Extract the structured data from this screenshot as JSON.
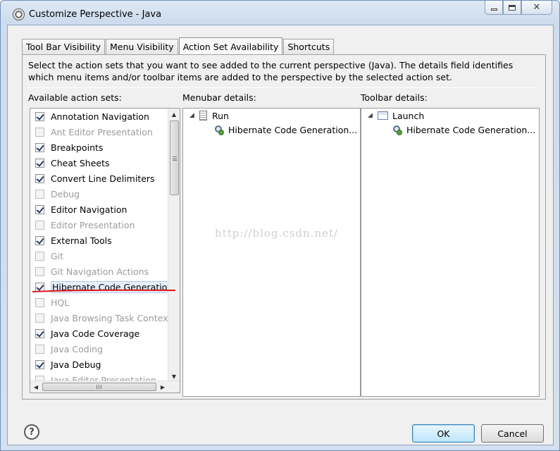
{
  "window": {
    "title": "Customize Perspective - Java"
  },
  "tabs": [
    {
      "label": "Tool Bar Visibility",
      "active": false
    },
    {
      "label": "Menu Visibility",
      "active": false
    },
    {
      "label": "Action Set Availability",
      "active": true
    },
    {
      "label": "Shortcuts",
      "active": false
    }
  ],
  "panel": {
    "description": "Select the action sets that you want to see added to the current perspective (Java).  The details field identifies which menu items and/or toolbar items are added to the perspective by the selected action set.",
    "available_label": "Available action sets:",
    "menubar_label": "Menubar details:",
    "toolbar_label": "Toolbar details:"
  },
  "action_sets": [
    {
      "label": "Annotation Navigation",
      "checked": true,
      "enabled": true
    },
    {
      "label": "Ant Editor Presentation",
      "checked": false,
      "enabled": false
    },
    {
      "label": "Breakpoints",
      "checked": true,
      "enabled": true
    },
    {
      "label": "Cheat Sheets",
      "checked": true,
      "enabled": true
    },
    {
      "label": "Convert Line Delimiters",
      "checked": true,
      "enabled": true
    },
    {
      "label": "Debug",
      "checked": false,
      "enabled": false
    },
    {
      "label": "Editor Navigation",
      "checked": true,
      "enabled": true
    },
    {
      "label": "Editor Presentation",
      "checked": false,
      "enabled": false
    },
    {
      "label": "External Tools",
      "checked": true,
      "enabled": true
    },
    {
      "label": "Git",
      "checked": false,
      "enabled": false
    },
    {
      "label": "Git Navigation Actions",
      "checked": false,
      "enabled": false
    },
    {
      "label": "Hibernate Code Generation",
      "checked": true,
      "enabled": true,
      "selected": true
    },
    {
      "label": "HQL",
      "checked": false,
      "enabled": false
    },
    {
      "label": "Java Browsing Task Context",
      "checked": false,
      "enabled": false
    },
    {
      "label": "Java Code Coverage",
      "checked": true,
      "enabled": true
    },
    {
      "label": "Java Coding",
      "checked": false,
      "enabled": false
    },
    {
      "label": "Java Debug",
      "checked": true,
      "enabled": true
    },
    {
      "label": "Java Editor Presentation",
      "checked": false,
      "enabled": false
    }
  ],
  "menubar_details": {
    "root": "Run",
    "child": "Hibernate Code Generation..."
  },
  "toolbar_details": {
    "root": "Launch",
    "child": "Hibernate Code Generation..."
  },
  "watermark": "http://blog.csdn.net/",
  "buttons": {
    "help": "?",
    "ok": "OK",
    "cancel": "Cancel"
  },
  "colors": {
    "selection_underline": "#e0141c",
    "default_button": "#bde6fd"
  }
}
